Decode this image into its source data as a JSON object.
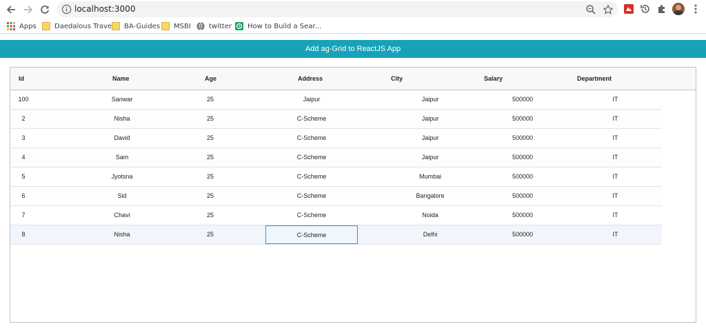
{
  "browser": {
    "url": "localhost:3000",
    "bookmarks": [
      "Apps",
      "Daedalous Travels",
      "BA-Guides",
      "MSBI",
      "twitter",
      "How to Build a Sear..."
    ]
  },
  "app": {
    "title": "Add ag-Grid to ReactJS App"
  },
  "grid": {
    "columns": [
      "Id",
      "Name",
      "Age",
      "Address",
      "City",
      "Salary",
      "Department"
    ],
    "rows": [
      [
        "100",
        "Sanwar",
        "25",
        "Jaipur",
        "Jaipur",
        "500000",
        "IT"
      ],
      [
        "2",
        "Nisha",
        "25",
        "C-Scheme",
        "Jaipur",
        "500000",
        "IT"
      ],
      [
        "3",
        "David",
        "25",
        "C-Scheme",
        "Jaipur",
        "500000",
        "IT"
      ],
      [
        "4",
        "Sam",
        "25",
        "C-Scheme",
        "Jaipur",
        "500000",
        "IT"
      ],
      [
        "5",
        "Jyotsna",
        "25",
        "C-Scheme",
        "Mumbai",
        "500000",
        "IT"
      ],
      [
        "6",
        "Sid",
        "25",
        "C-Scheme",
        "Bangalore",
        "500000",
        "IT"
      ],
      [
        "7",
        "Chavi",
        "25",
        "C-Scheme",
        "Noida",
        "500000",
        "IT"
      ],
      [
        "8",
        "Nisha",
        "25",
        "C-Scheme",
        "Delhi",
        "500000",
        "IT"
      ]
    ],
    "selected_row_index": 7,
    "focused_cell": {
      "row_index": 7,
      "column": "Address"
    }
  }
}
